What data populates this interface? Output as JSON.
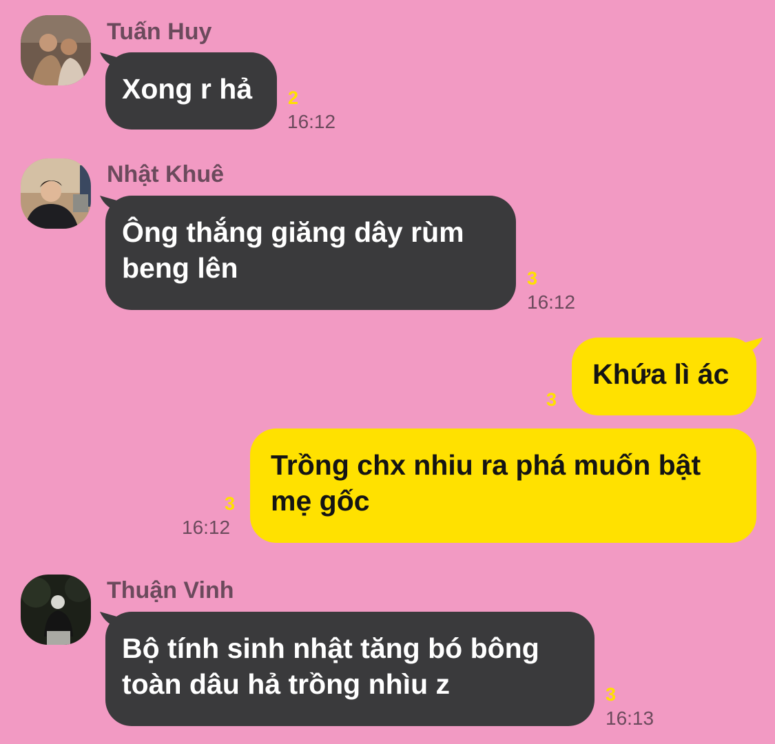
{
  "colors": {
    "background": "#f29ac3",
    "incoming_bubble": "#3a3a3c",
    "outgoing_bubble": "#ffe100",
    "unread": "#ffe100",
    "meta_text": "#6b4a5c"
  },
  "messages": [
    {
      "sender": "Tuấn Huy",
      "text": "Xong r hả",
      "unread": "2",
      "time": "16:12",
      "direction": "incoming"
    },
    {
      "sender": "Nhật Khuê",
      "text": "Ông thắng giăng dây rùm beng lên",
      "unread": "3",
      "time": "16:12",
      "direction": "incoming"
    },
    {
      "text": "Khứa lì ác",
      "unread": "3",
      "direction": "outgoing"
    },
    {
      "text": "Trồng chx nhiu ra phá muốn bật mẹ gốc",
      "unread": "3",
      "time": "16:12",
      "direction": "outgoing"
    },
    {
      "sender": "Thuận Vinh",
      "text": "Bộ tính sinh nhật tăng bó bông toàn dâu hả trồng nhìu z",
      "unread": "3",
      "time": "16:13",
      "direction": "incoming"
    }
  ]
}
